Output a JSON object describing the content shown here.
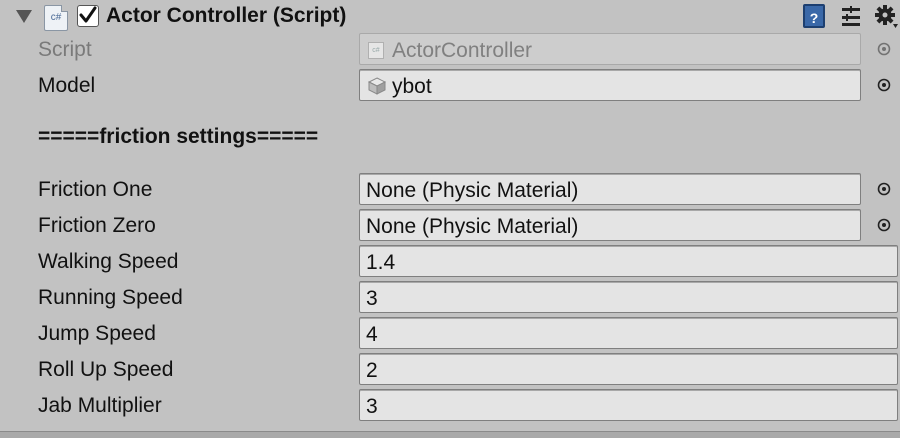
{
  "component": {
    "title": "Actor Controller (Script)",
    "enabled": true,
    "script_icon_text": "c#"
  },
  "fields": {
    "script": {
      "label": "Script",
      "value": "ActorController"
    },
    "model": {
      "label": "Model",
      "value": "ybot"
    }
  },
  "section": {
    "title": "=====friction settings====="
  },
  "friction": {
    "one": {
      "label": "Friction One",
      "value": "None (Physic Material)"
    },
    "zero": {
      "label": "Friction Zero",
      "value": "None (Physic Material)"
    }
  },
  "speeds": {
    "walking": {
      "label": "Walking Speed",
      "value": "1.4"
    },
    "running": {
      "label": "Running Speed",
      "value": "3"
    },
    "jump": {
      "label": "Jump Speed",
      "value": "4"
    },
    "roll_up": {
      "label": "Roll Up Speed",
      "value": "2"
    },
    "jab": {
      "label": "Jab Multiplier",
      "value": "3"
    }
  },
  "icons": {
    "foldout": "triangle-down-icon",
    "script": "csharp-script-icon",
    "help": "help-book-icon",
    "presets": "presets-icon",
    "settings": "gear-icon",
    "picker": "object-picker-icon",
    "mesh": "mesh-cube-icon"
  },
  "colors": {
    "background": "#c2c2c2",
    "field": "#e4e4e4",
    "help_blue": "#3a68a8"
  }
}
